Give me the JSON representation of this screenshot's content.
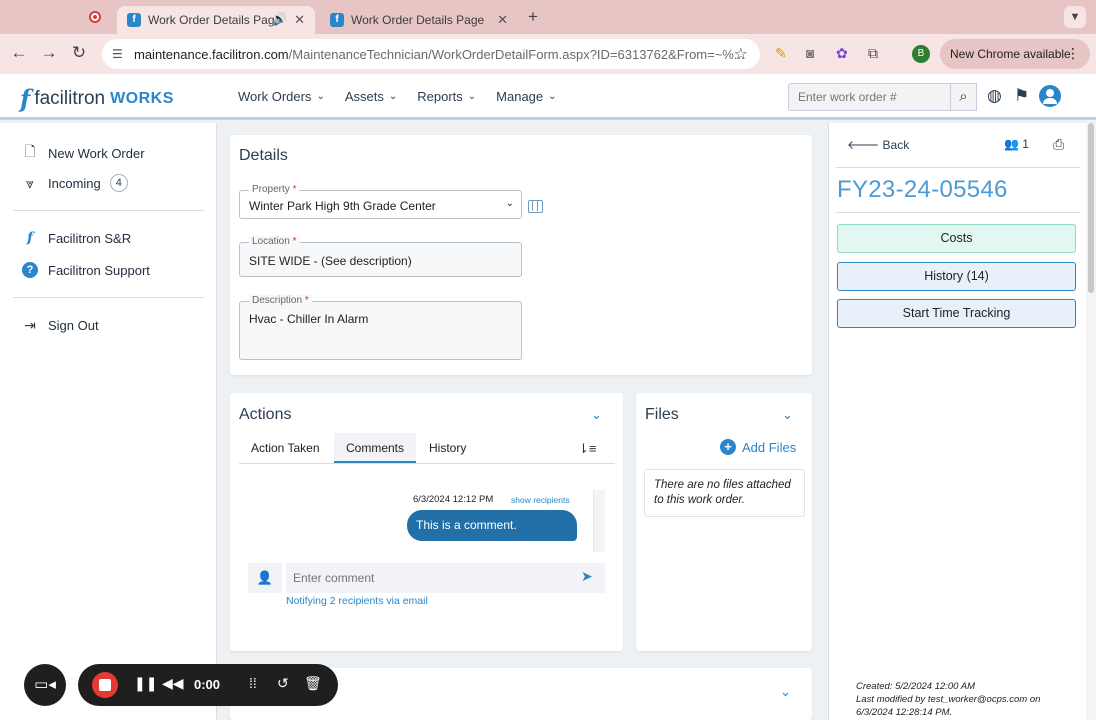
{
  "browser": {
    "tabs": [
      {
        "title": "Work Order Details Page",
        "active": true,
        "audio": true
      },
      {
        "title": "Work Order Details Page",
        "active": false
      }
    ],
    "url_host": "maintenance.facilitron.com",
    "url_path": "/MaintenanceTechnician/WorkOrderDetailForm.aspx?ID=6313762&From=~%...",
    "profile_initial": "B",
    "update_label": "New Chrome available"
  },
  "header": {
    "logo_text": "facilitron",
    "logo_suffix": "WORKS",
    "nav": [
      "Work Orders",
      "Assets",
      "Reports",
      "Manage"
    ],
    "search_placeholder": "Enter work order #"
  },
  "sidebar": {
    "items": [
      {
        "label": "New Work Order",
        "icon": "file-plus-icon"
      },
      {
        "label": "Incoming",
        "icon": "chevrons-down-icon",
        "badge": "4"
      },
      {
        "label": "Facilitron S&R",
        "icon": "facilitron-logo-icon"
      },
      {
        "label": "Facilitron Support",
        "icon": "help-circle-icon"
      },
      {
        "label": "Sign Out",
        "icon": "sign-out-icon"
      }
    ]
  },
  "details": {
    "title": "Details",
    "property": {
      "label": "Property",
      "value": "Winter Park High 9th Grade Center"
    },
    "location": {
      "label": "Location",
      "value": "SITE WIDE - (See description)"
    },
    "description": {
      "label": "Description",
      "value": "Hvac - Chiller In Alarm"
    }
  },
  "actions": {
    "title": "Actions",
    "tabs": [
      "Action Taken",
      "Comments",
      "History"
    ],
    "active_tab": "Comments",
    "comment": {
      "timestamp": "6/3/2024 12:12 PM",
      "recipients_link": "show recipients",
      "text": "This is a comment."
    },
    "input_placeholder": "Enter comment",
    "notify_text": "Notifying 2 recipients via email"
  },
  "files": {
    "title": "Files",
    "add_label": "Add Files",
    "empty_text": "There are no files attached to this work order."
  },
  "rightpanel": {
    "back_label": "Back",
    "people_count": "1",
    "wo_number": "FY23-24-05546",
    "buttons": [
      "Costs",
      "History (14)",
      "Start Time Tracking"
    ],
    "created": "Created: 5/2/2024 12:00 AM",
    "modified_line1": "Last modified by test_worker@ocps.com on",
    "modified_line2": "6/3/2024 12:28:14 PM."
  },
  "recorder": {
    "time": "0:00"
  },
  "colors": {
    "accent": "#2a86c8",
    "wo_number": "#4a9bd6",
    "costs_bg": "#e2f7f1",
    "stop_red": "#e53935"
  }
}
